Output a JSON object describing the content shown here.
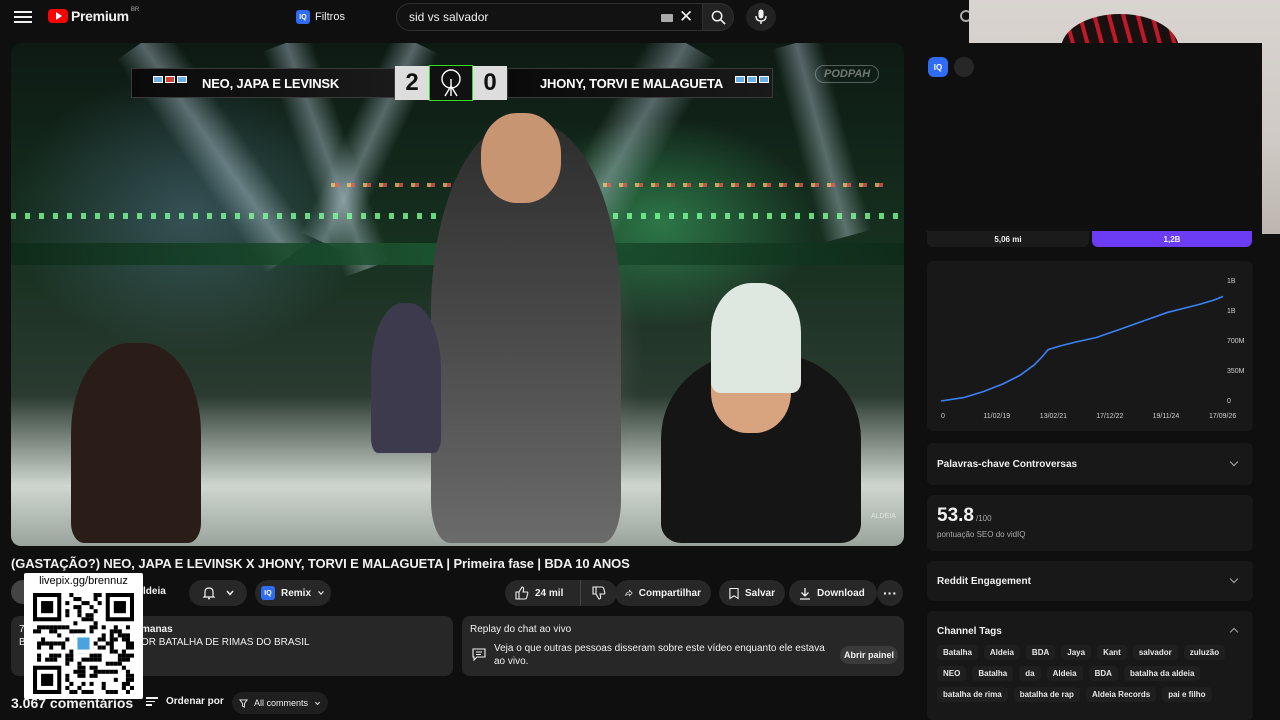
{
  "topbar": {
    "logo_text": "Premium",
    "logo_region": "BR",
    "filters_label": "Filtros",
    "search_value": "sid vs salvador"
  },
  "video": {
    "team_a": "NEO, JAPA E LEVINSK",
    "team_b": "JHONY, TORVI E MALAGUETA",
    "score_a": "2",
    "score_b": "0",
    "watermark": "PODPAH",
    "corner_mark": "ALDEIA",
    "title": "(GASTAÇÃO?) NEO, JAPA E LEVINSK X JHONY, TORVI E MALAGUETA | Primeira fase | BDA 10 ANOS",
    "channel_name": "ldeia"
  },
  "actions": {
    "remix_label": "Remix",
    "like_count": "24 mil",
    "share_label": "Compartilhar",
    "save_label": "Salvar",
    "download_label": "Download",
    "more_label": "···"
  },
  "description": {
    "line1_prefix": "7",
    "meta": "manas",
    "line2_prefix": "B",
    "line2": "OR BATALHA DE RIMAS DO BRASIL"
  },
  "chat_replay": {
    "title": "Replay do chat ao vivo",
    "text": "Veja o que outras pessoas disseram sobre este vídeo enquanto ele estava ao vivo.",
    "button": "Abrir painel"
  },
  "comments": {
    "count": "3.067 comentários",
    "sort_label": "Ordenar por",
    "filter_label": "All comments"
  },
  "qr": {
    "label": "livepix.gg/brennuz"
  },
  "vidiq": {
    "badge": "IQ",
    "stat_left": "5,06 mi",
    "stat_right": "1,2B",
    "keywords_title": "Palavras-chave Controversas",
    "seo_score": "53.8",
    "seo_max": "/100",
    "seo_label": "pontuação SEO do vidIQ",
    "reddit_title": "Reddit Engagement",
    "tags_title": "Channel Tags",
    "tags": [
      "Batalha",
      "Aldeia",
      "BDA",
      "Jaya",
      "Kant",
      "salvador",
      "zuluzão",
      "NEO",
      "Batalha",
      "da",
      "Aldeia",
      "BDA",
      "batalha da aldeia",
      "batalha de rima",
      "batalha de rap",
      "Aldeia Records",
      "pai e filho"
    ]
  },
  "chart_data": {
    "type": "line",
    "x_tick_labels": [
      "0",
      "11/02/19",
      "13/02/21",
      "17/12/22",
      "19/11/24",
      "17/09/26"
    ],
    "y_tick_labels": [
      "0",
      "350M",
      "700M",
      "1B",
      "1B"
    ],
    "ylim": [
      0,
      1400
    ],
    "x": [
      0,
      0.08,
      0.15,
      0.22,
      0.28,
      0.33,
      0.36,
      0.38,
      0.42,
      0.48,
      0.55,
      0.62,
      0.68,
      0.74,
      0.8,
      0.86,
      0.92,
      0.97,
      1.0
    ],
    "values": [
      0,
      40,
      110,
      200,
      300,
      420,
      520,
      600,
      640,
      690,
      740,
      820,
      890,
      960,
      1030,
      1080,
      1130,
      1180,
      1220
    ],
    "color": "#3b82f6",
    "grid": false
  }
}
